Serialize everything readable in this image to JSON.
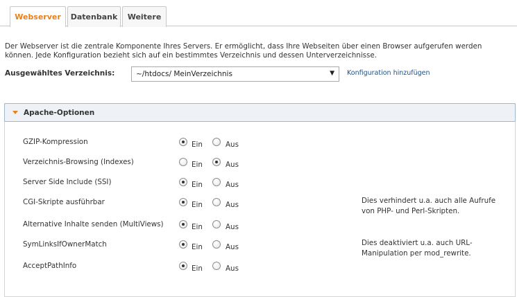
{
  "tabs": [
    {
      "label": "Webserver",
      "active": true
    },
    {
      "label": "Datenbank",
      "active": false
    },
    {
      "label": "Weitere",
      "active": false
    }
  ],
  "description": "Der Webserver ist die zentrale Komponente Ihres Servers. Er ermöglicht, dass Ihre Webseiten über einen Browser aufgerufen werden können. Jede Konfiguration bezieht sich auf ein bestimmtes Verzeichnis und dessen Unterverzeichnisse.",
  "directory": {
    "label": "Ausgewähltes Verzeichnis:",
    "value": "~/htdocs/ MeinVerzeichnis",
    "add_link": "Konfiguration hinzufügen"
  },
  "panel": {
    "title": "Apache-Optionen",
    "ein_label": "Ein",
    "aus_label": "Aus",
    "options": [
      {
        "label": "GZIP-Kompression",
        "selected": "ein",
        "note": ""
      },
      {
        "label": "Verzeichnis-Browsing (Indexes)",
        "selected": "aus",
        "note": ""
      },
      {
        "label": "Server Side Include (SSI)",
        "selected": "ein",
        "note": ""
      },
      {
        "label": "CGI-Skripte ausführbar",
        "selected": "ein",
        "note": "Dies verhindert u.a. auch alle Aufrufe von PHP- und Perl-Skripten."
      },
      {
        "label": "Alternative Inhalte senden (MultiViews)",
        "selected": "ein",
        "note": ""
      },
      {
        "label": "SymLinksIfOwnerMatch",
        "selected": "ein",
        "note": "Dies deaktiviert u.a. auch URL-Manipulation per mod_rewrite."
      },
      {
        "label": "AcceptPathInfo",
        "selected": "ein",
        "note": ""
      }
    ]
  },
  "colors": {
    "accent": "#e8801c",
    "link": "#1d4f88",
    "panel_header_bg": "#eef2f6",
    "panel_header_border": "#9fb7cf"
  }
}
